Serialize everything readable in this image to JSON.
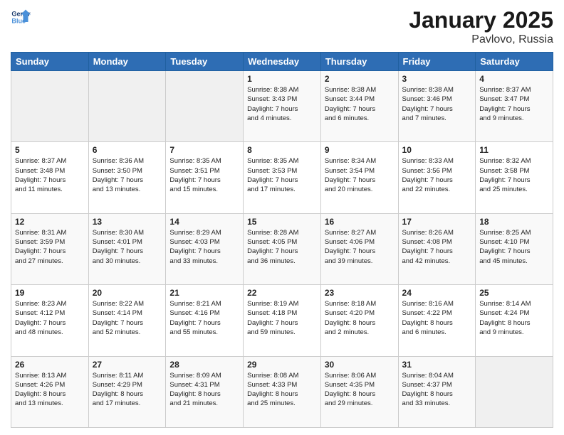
{
  "header": {
    "logo_line1": "General",
    "logo_line2": "Blue",
    "title": "January 2025",
    "subtitle": "Pavlovo, Russia"
  },
  "days_of_week": [
    "Sunday",
    "Monday",
    "Tuesday",
    "Wednesday",
    "Thursday",
    "Friday",
    "Saturday"
  ],
  "weeks": [
    [
      {
        "day": "",
        "info": ""
      },
      {
        "day": "",
        "info": ""
      },
      {
        "day": "",
        "info": ""
      },
      {
        "day": "1",
        "info": "Sunrise: 8:38 AM\nSunset: 3:43 PM\nDaylight: 7 hours\nand 4 minutes."
      },
      {
        "day": "2",
        "info": "Sunrise: 8:38 AM\nSunset: 3:44 PM\nDaylight: 7 hours\nand 6 minutes."
      },
      {
        "day": "3",
        "info": "Sunrise: 8:38 AM\nSunset: 3:46 PM\nDaylight: 7 hours\nand 7 minutes."
      },
      {
        "day": "4",
        "info": "Sunrise: 8:37 AM\nSunset: 3:47 PM\nDaylight: 7 hours\nand 9 minutes."
      }
    ],
    [
      {
        "day": "5",
        "info": "Sunrise: 8:37 AM\nSunset: 3:48 PM\nDaylight: 7 hours\nand 11 minutes."
      },
      {
        "day": "6",
        "info": "Sunrise: 8:36 AM\nSunset: 3:50 PM\nDaylight: 7 hours\nand 13 minutes."
      },
      {
        "day": "7",
        "info": "Sunrise: 8:35 AM\nSunset: 3:51 PM\nDaylight: 7 hours\nand 15 minutes."
      },
      {
        "day": "8",
        "info": "Sunrise: 8:35 AM\nSunset: 3:53 PM\nDaylight: 7 hours\nand 17 minutes."
      },
      {
        "day": "9",
        "info": "Sunrise: 8:34 AM\nSunset: 3:54 PM\nDaylight: 7 hours\nand 20 minutes."
      },
      {
        "day": "10",
        "info": "Sunrise: 8:33 AM\nSunset: 3:56 PM\nDaylight: 7 hours\nand 22 minutes."
      },
      {
        "day": "11",
        "info": "Sunrise: 8:32 AM\nSunset: 3:58 PM\nDaylight: 7 hours\nand 25 minutes."
      }
    ],
    [
      {
        "day": "12",
        "info": "Sunrise: 8:31 AM\nSunset: 3:59 PM\nDaylight: 7 hours\nand 27 minutes."
      },
      {
        "day": "13",
        "info": "Sunrise: 8:30 AM\nSunset: 4:01 PM\nDaylight: 7 hours\nand 30 minutes."
      },
      {
        "day": "14",
        "info": "Sunrise: 8:29 AM\nSunset: 4:03 PM\nDaylight: 7 hours\nand 33 minutes."
      },
      {
        "day": "15",
        "info": "Sunrise: 8:28 AM\nSunset: 4:05 PM\nDaylight: 7 hours\nand 36 minutes."
      },
      {
        "day": "16",
        "info": "Sunrise: 8:27 AM\nSunset: 4:06 PM\nDaylight: 7 hours\nand 39 minutes."
      },
      {
        "day": "17",
        "info": "Sunrise: 8:26 AM\nSunset: 4:08 PM\nDaylight: 7 hours\nand 42 minutes."
      },
      {
        "day": "18",
        "info": "Sunrise: 8:25 AM\nSunset: 4:10 PM\nDaylight: 7 hours\nand 45 minutes."
      }
    ],
    [
      {
        "day": "19",
        "info": "Sunrise: 8:23 AM\nSunset: 4:12 PM\nDaylight: 7 hours\nand 48 minutes."
      },
      {
        "day": "20",
        "info": "Sunrise: 8:22 AM\nSunset: 4:14 PM\nDaylight: 7 hours\nand 52 minutes."
      },
      {
        "day": "21",
        "info": "Sunrise: 8:21 AM\nSunset: 4:16 PM\nDaylight: 7 hours\nand 55 minutes."
      },
      {
        "day": "22",
        "info": "Sunrise: 8:19 AM\nSunset: 4:18 PM\nDaylight: 7 hours\nand 59 minutes."
      },
      {
        "day": "23",
        "info": "Sunrise: 8:18 AM\nSunset: 4:20 PM\nDaylight: 8 hours\nand 2 minutes."
      },
      {
        "day": "24",
        "info": "Sunrise: 8:16 AM\nSunset: 4:22 PM\nDaylight: 8 hours\nand 6 minutes."
      },
      {
        "day": "25",
        "info": "Sunrise: 8:14 AM\nSunset: 4:24 PM\nDaylight: 8 hours\nand 9 minutes."
      }
    ],
    [
      {
        "day": "26",
        "info": "Sunrise: 8:13 AM\nSunset: 4:26 PM\nDaylight: 8 hours\nand 13 minutes."
      },
      {
        "day": "27",
        "info": "Sunrise: 8:11 AM\nSunset: 4:29 PM\nDaylight: 8 hours\nand 17 minutes."
      },
      {
        "day": "28",
        "info": "Sunrise: 8:09 AM\nSunset: 4:31 PM\nDaylight: 8 hours\nand 21 minutes."
      },
      {
        "day": "29",
        "info": "Sunrise: 8:08 AM\nSunset: 4:33 PM\nDaylight: 8 hours\nand 25 minutes."
      },
      {
        "day": "30",
        "info": "Sunrise: 8:06 AM\nSunset: 4:35 PM\nDaylight: 8 hours\nand 29 minutes."
      },
      {
        "day": "31",
        "info": "Sunrise: 8:04 AM\nSunset: 4:37 PM\nDaylight: 8 hours\nand 33 minutes."
      },
      {
        "day": "",
        "info": ""
      }
    ]
  ]
}
